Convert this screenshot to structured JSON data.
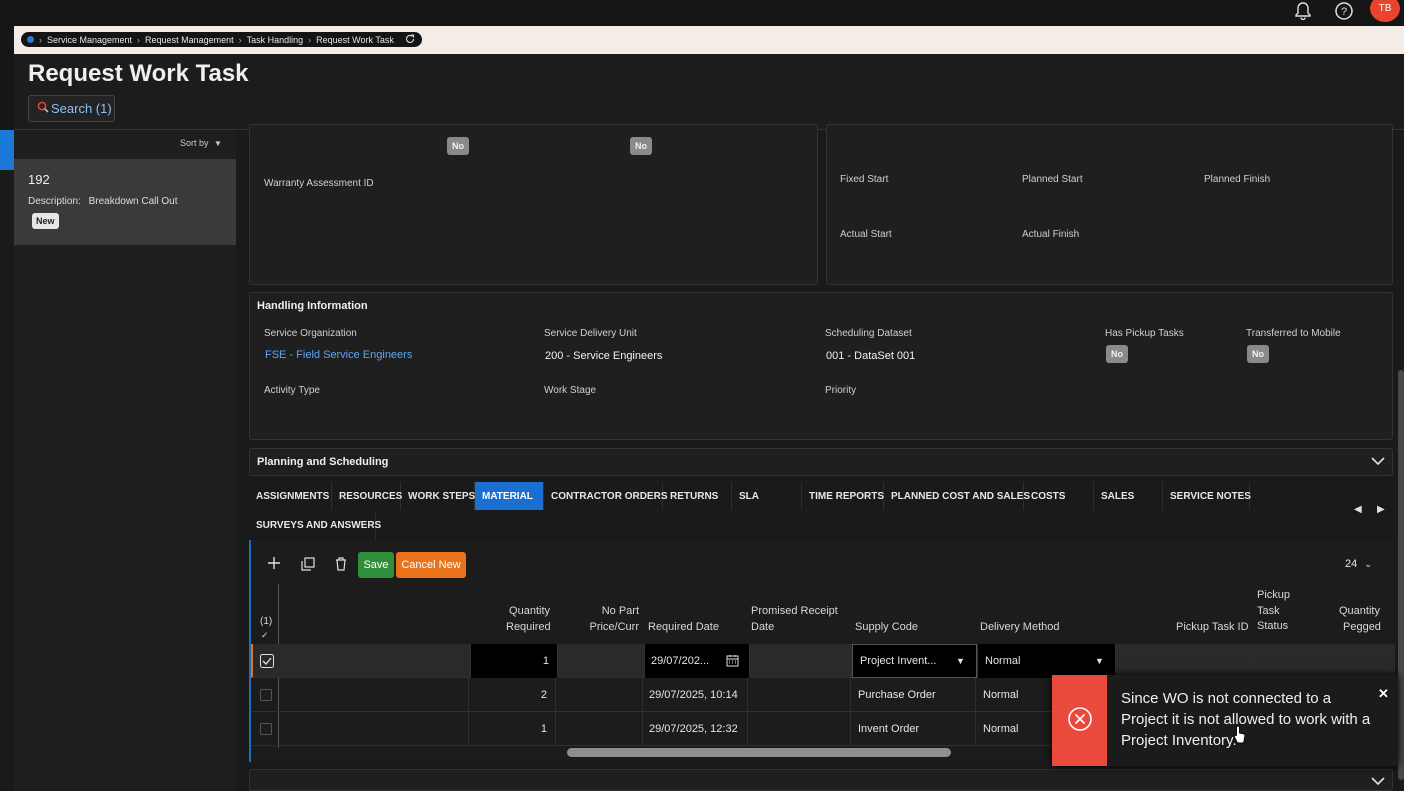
{
  "breadcrumb": [
    "Service Management",
    "Request Management",
    "Task Handling",
    "Request Work Task"
  ],
  "topbar": {
    "avatar": "TB",
    "icons": [
      "bell-icon",
      "help-icon"
    ]
  },
  "page_title": "Request Work Task",
  "search_label": "Search (1)",
  "sort_label": "Sort by",
  "record": {
    "id": "192",
    "description_label": "Description:",
    "description": "Breakdown Call Out",
    "status": "New"
  },
  "top_left_panel": {
    "badge1": "No",
    "badge2": "No",
    "warranty_label": "Warranty Assessment ID"
  },
  "top_right_panel": {
    "fixed_start": "Fixed Start",
    "planned_start": "Planned Start",
    "planned_finish": "Planned Finish",
    "actual_start": "Actual Start",
    "actual_finish": "Actual Finish"
  },
  "handling": {
    "title": "Handling Information",
    "service_org_label": "Service Organization",
    "service_org_value": "FSE - Field Service Engineers",
    "sdu_label": "Service Delivery Unit",
    "sdu_value": "200 - Service Engineers",
    "dataset_label": "Scheduling Dataset",
    "dataset_value": "001 - DataSet 001",
    "pickup_label": "Has Pickup Tasks",
    "pickup_value": "No",
    "mobile_label": "Transferred to Mobile",
    "mobile_value": "No",
    "activity_label": "Activity Type",
    "workstage_label": "Work Stage",
    "priority_label": "Priority"
  },
  "planning_title": "Planning and Scheduling",
  "tabs": [
    "ASSIGNMENTS",
    "RESOURCES",
    "WORK STEPS",
    "MATERIAL",
    "CONTRACTOR ORDERS",
    "RETURNS",
    "SLA",
    "TIME REPORTS",
    "PLANNED COST AND SALES",
    "COSTS",
    "SALES",
    "SERVICE NOTES",
    "SURVEYS AND ANSWERS"
  ],
  "active_tab": "MATERIAL",
  "toolbar": {
    "save": "Save",
    "cancel_new": "Cancel New",
    "page_size": "24"
  },
  "columns": {
    "select_count": "(1)",
    "qty_required_1": "Quantity",
    "qty_required_2": "Required",
    "no_part_1": "No Part",
    "no_part_2": "Price/Curr",
    "required_date": "Required Date",
    "promised_1": "Promised Receipt",
    "promised_2": "Date",
    "supply_code": "Supply Code",
    "delivery_method": "Delivery Method",
    "pickup_task_id": "Pickup Task ID",
    "pickup_status_1": "Pickup",
    "pickup_status_2": "Task",
    "pickup_status_3": "Status",
    "qty_pegged_1": "Quantity",
    "qty_pegged_2": "Pegged"
  },
  "rows": [
    {
      "qty": "1",
      "required_date": "29/07/202...",
      "supply_code": "Project Invent...",
      "delivery_method": "Normal",
      "selected": true
    },
    {
      "qty": "2",
      "required_date": "29/07/2025, 10:14",
      "supply_code": "Purchase Order",
      "delivery_method": "Normal",
      "selected": false
    },
    {
      "qty": "1",
      "required_date": "29/07/2025, 12:32",
      "supply_code": "Invent Order",
      "delivery_method": "Normal",
      "selected": false
    }
  ],
  "toast": {
    "message": "Since WO is not connected to a Project it is not allowed to work with a Project Inventory."
  },
  "colors": {
    "accent": "#1a6fd0",
    "save": "#2f8f3a",
    "cancel": "#e8731a",
    "error": "#ea4a3b"
  }
}
